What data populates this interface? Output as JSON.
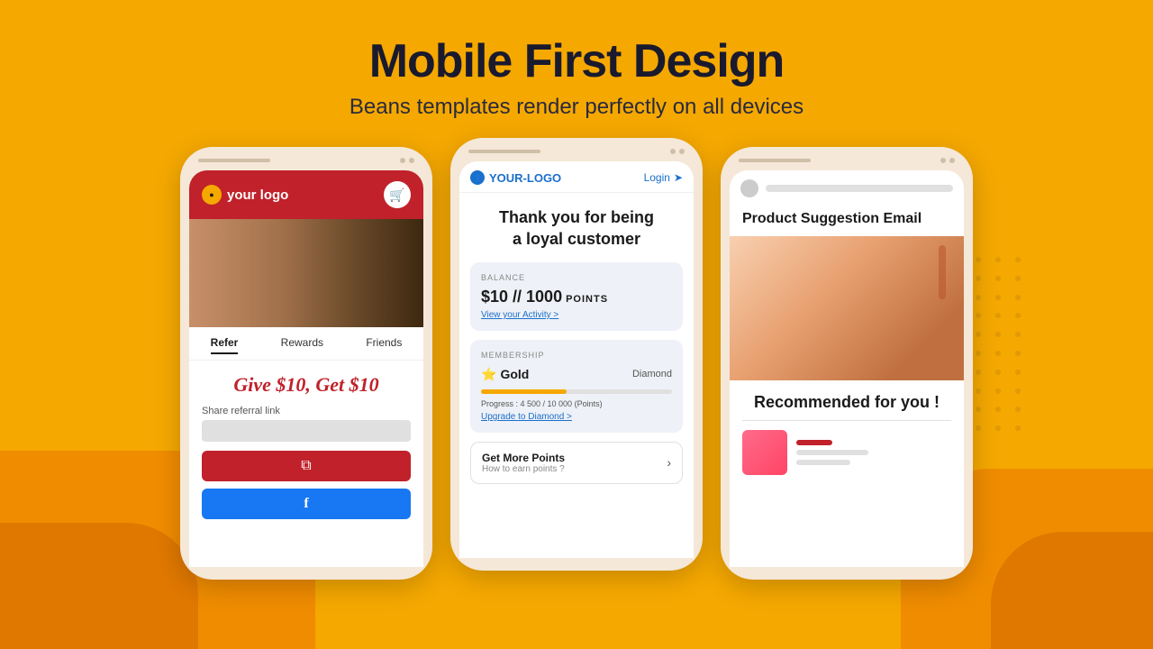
{
  "header": {
    "title": "Mobile First Design",
    "subtitle": "Beans templates render perfectly on all devices"
  },
  "phone1": {
    "logo_text": "your logo",
    "tab_refer": "Refer",
    "tab_rewards": "Rewards",
    "tab_friends": "Friends",
    "give_text": "Give $10, Get $10",
    "share_label": "Share referral link",
    "copy_icon": "⧉",
    "facebook_icon": "f"
  },
  "phone2": {
    "logo_text": "YOUR-LOGO",
    "login_text": "Login",
    "title_line1": "Thank you for being",
    "title_line2": "a loyal customer",
    "balance_label": "BALANCE",
    "balance_amount": "$10 // 1000",
    "balance_points": "POINTS",
    "view_activity": "View your Activity >",
    "membership_label": "MEMBERSHIP",
    "gold_label": "Gold",
    "diamond_label": "Diamond",
    "progress_text": "Progress : 4 500 / 10 000 (Points)",
    "upgrade_text": "Upgrade to Diamond >",
    "get_points_title": "Get More Points",
    "get_points_subtitle": "How to earn points ?"
  },
  "phone3": {
    "email_subject": "Product Suggestion Email",
    "recommended_title": "Recommended for you !"
  },
  "colors": {
    "background": "#F5A800",
    "red": "#C0212A",
    "blue": "#1877F2",
    "navy": "#1a1a2e"
  }
}
